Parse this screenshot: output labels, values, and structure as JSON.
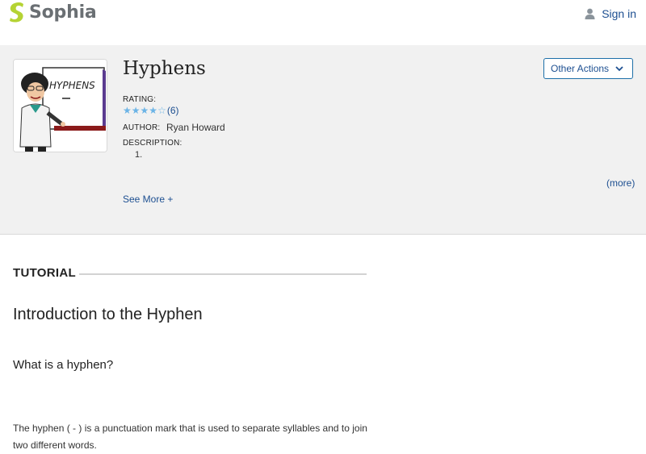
{
  "brand": {
    "name": "Sophia",
    "mark_color": "#b5d334"
  },
  "nav": {
    "signin_label": "Sign in",
    "icon": "user-icon"
  },
  "resource": {
    "title": "Hyphens",
    "thumbnail_text": "HYPHENS",
    "other_actions_label": "Other Actions",
    "rating_label": "RATING:",
    "rating_stars": 4,
    "rating_max": 5,
    "rating_count": "(6)",
    "author_label": "AUTHOR:",
    "author": "Ryan Howard",
    "description_label": "DESCRIPTION:",
    "description_item": "1.",
    "more_label": "(more)",
    "see_more_label": "See More +"
  },
  "content": {
    "section_label": "TUTORIAL",
    "heading": "Introduction to the Hyphen",
    "question": "What is a hyphen?",
    "paragraph": "The hyphen ( - ) is a punctuation mark that is used to separate syllables and to join two different words."
  },
  "colors": {
    "link": "#1d4f91",
    "star": "#6cb4e6",
    "band": "#f1f1f1"
  }
}
